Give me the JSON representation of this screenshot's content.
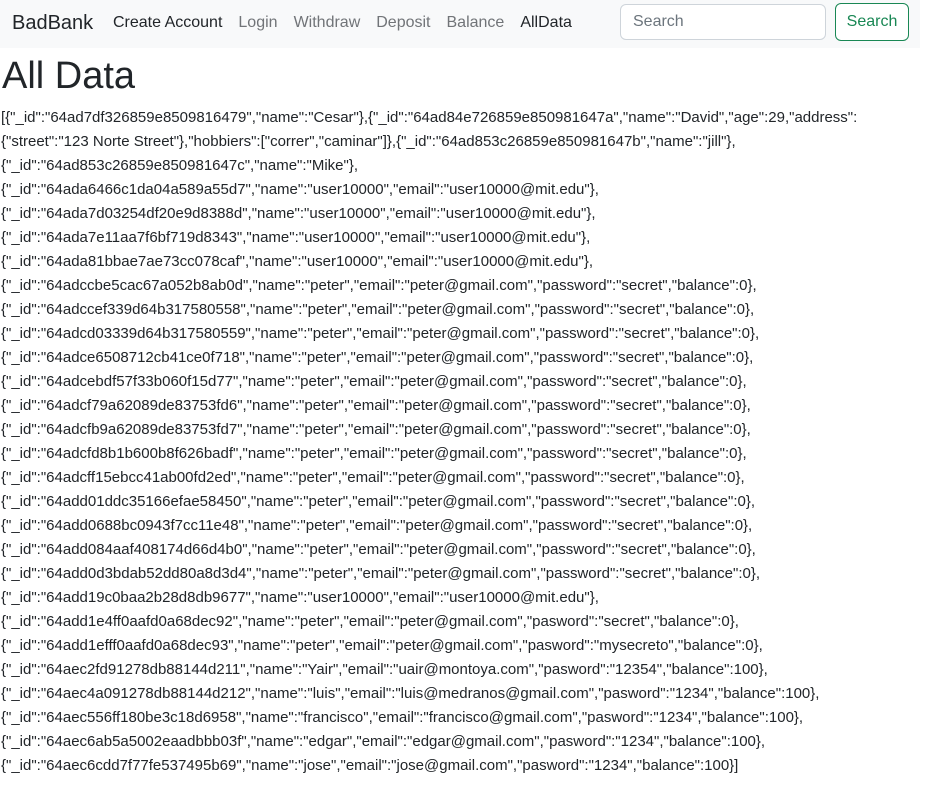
{
  "navbar": {
    "brand": "BadBank",
    "links": [
      {
        "label": "Create Account"
      },
      {
        "label": "Login"
      },
      {
        "label": "Withdraw"
      },
      {
        "label": "Deposit"
      },
      {
        "label": "Balance"
      },
      {
        "label": "AllData"
      }
    ],
    "search": {
      "placeholder": "Search",
      "value": "",
      "button_label": "Search"
    }
  },
  "main": {
    "title": "All Data",
    "lines": [
      "[{\"_id\":\"64ad7df326859e8509816479\",\"name\":\"Cesar\"},{\"_id\":\"64ad84e726859e850981647a\",\"name\":\"David\",\"age\":29,\"address\":",
      "{\"street\":\"123 Norte Street\"},\"hobbiers\":[\"correr\",\"caminar\"]},{\"_id\":\"64ad853c26859e850981647b\",\"name\":\"jill\"},",
      "{\"_id\":\"64ad853c26859e850981647c\",\"name\":\"Mike\"},",
      "{\"_id\":\"64ada6466c1da04a589a55d7\",\"name\":\"user10000\",\"email\":\"user10000@mit.edu\"},",
      "{\"_id\":\"64ada7d03254df20e9d8388d\",\"name\":\"user10000\",\"email\":\"user10000@mit.edu\"},",
      "{\"_id\":\"64ada7e11aa7f6bf719d8343\",\"name\":\"user10000\",\"email\":\"user10000@mit.edu\"},",
      "{\"_id\":\"64ada81bbae7ae73cc078caf\",\"name\":\"user10000\",\"email\":\"user10000@mit.edu\"},",
      "{\"_id\":\"64adccbe5cac67a052b8ab0d\",\"name\":\"peter\",\"email\":\"peter@gmail.com\",\"password\":\"secret\",\"balance\":0},",
      "{\"_id\":\"64adccef339d64b317580558\",\"name\":\"peter\",\"email\":\"peter@gmail.com\",\"password\":\"secret\",\"balance\":0},",
      "{\"_id\":\"64adcd03339d64b317580559\",\"name\":\"peter\",\"email\":\"peter@gmail.com\",\"password\":\"secret\",\"balance\":0},",
      "{\"_id\":\"64adce6508712cb41ce0f718\",\"name\":\"peter\",\"email\":\"peter@gmail.com\",\"password\":\"secret\",\"balance\":0},",
      "{\"_id\":\"64adcebdf57f33b060f15d77\",\"name\":\"peter\",\"email\":\"peter@gmail.com\",\"password\":\"secret\",\"balance\":0},",
      "{\"_id\":\"64adcf79a62089de83753fd6\",\"name\":\"peter\",\"email\":\"peter@gmail.com\",\"password\":\"secret\",\"balance\":0},",
      "{\"_id\":\"64adcfb9a62089de83753fd7\",\"name\":\"peter\",\"email\":\"peter@gmail.com\",\"password\":\"secret\",\"balance\":0},",
      "{\"_id\":\"64adcfd8b1b600b8f626badf\",\"name\":\"peter\",\"email\":\"peter@gmail.com\",\"password\":\"secret\",\"balance\":0},",
      "{\"_id\":\"64adcff15ebcc41ab00fd2ed\",\"name\":\"peter\",\"email\":\"peter@gmail.com\",\"password\":\"secret\",\"balance\":0},",
      "{\"_id\":\"64add01ddc35166efae58450\",\"name\":\"peter\",\"email\":\"peter@gmail.com\",\"password\":\"secret\",\"balance\":0},",
      "{\"_id\":\"64add0688bc0943f7cc11e48\",\"name\":\"peter\",\"email\":\"peter@gmail.com\",\"password\":\"secret\",\"balance\":0},",
      "{\"_id\":\"64add084aaf408174d66d4b0\",\"name\":\"peter\",\"email\":\"peter@gmail.com\",\"password\":\"secret\",\"balance\":0},",
      "{\"_id\":\"64add0d3bdab52dd80a8d3d4\",\"name\":\"peter\",\"email\":\"peter@gmail.com\",\"password\":\"secret\",\"balance\":0},",
      "{\"_id\":\"64add19c0baa2b28d8db9677\",\"name\":\"user10000\",\"email\":\"user10000@mit.edu\"},",
      "{\"_id\":\"64add1e4ff0aafd0a68dec92\",\"name\":\"peter\",\"email\":\"peter@gmail.com\",\"pasword\":\"secret\",\"balance\":0},",
      "{\"_id\":\"64add1efff0aafd0a68dec93\",\"name\":\"peter\",\"email\":\"peter@gmail.com\",\"pasword\":\"mysecreto\",\"balance\":0},",
      "{\"_id\":\"64aec2fd91278db88144d211\",\"name\":\"Yair\",\"email\":\"uair@montoya.com\",\"pasword\":\"12354\",\"balance\":100},",
      "{\"_id\":\"64aec4a091278db88144d212\",\"name\":\"luis\",\"email\":\"luis@medranos@gmail.com\",\"pasword\":\"1234\",\"balance\":100},",
      "{\"_id\":\"64aec556ff180be3c18d6958\",\"name\":\"francisco\",\"email\":\"francisco@gmail.com\",\"pasword\":\"1234\",\"balance\":100},",
      "{\"_id\":\"64aec6ab5a5002eaadbbb03f\",\"name\":\"edgar\",\"email\":\"edgar@gmail.com\",\"pasword\":\"1234\",\"balance\":100},",
      "{\"_id\":\"64aec6cdd7f77fe537495b69\",\"name\":\"jose\",\"email\":\"jose@gmail.com\",\"pasword\":\"1234\",\"balance\":100}]"
    ]
  }
}
